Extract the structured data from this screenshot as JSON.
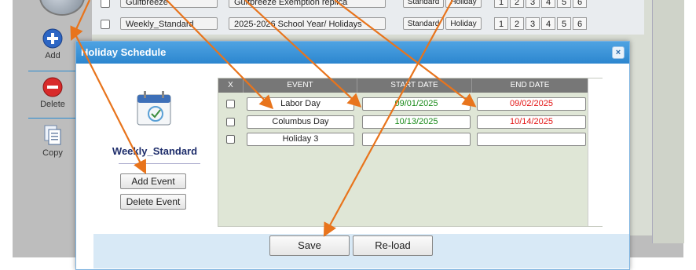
{
  "background_table": {
    "rows": [
      {
        "name": "Gulfbreeze",
        "description": "Gulfbreeze Exemption replica",
        "standard": "Standard",
        "holiday": "Holiday",
        "numbers": [
          "1",
          "2",
          "3",
          "4",
          "5",
          "6"
        ]
      },
      {
        "name": "Weekly_Standard",
        "description": "2025-2026 School Year/ Holidays",
        "standard": "Standard",
        "holiday": "Holiday",
        "numbers": [
          "1",
          "2",
          "3",
          "4",
          "5",
          "6"
        ]
      }
    ]
  },
  "sidebar": {
    "items": [
      {
        "label": "Add",
        "icon": "add-icon"
      },
      {
        "label": "Delete",
        "icon": "delete-icon"
      },
      {
        "label": "Copy",
        "icon": "copy-icon"
      }
    ]
  },
  "modal": {
    "title": "Holiday Schedule",
    "close_label": "×",
    "schedule_name": "Weekly_Standard",
    "add_event_label": "Add Event",
    "delete_event_label": "Delete Event",
    "table": {
      "headers": [
        "X",
        "EVENT",
        "START DATE",
        "END DATE"
      ],
      "rows": [
        {
          "event": "Labor Day",
          "start": "09/01/2025",
          "end": "09/02/2025"
        },
        {
          "event": "Columbus Day",
          "start": "10/13/2025",
          "end": "10/14/2025"
        },
        {
          "event": "Holiday 3",
          "start": "",
          "end": ""
        }
      ]
    },
    "save_label": "Save",
    "reload_label": "Re-load"
  },
  "colors": {
    "start_date": "#1a8a1a",
    "end_date": "#e31414",
    "header_blue": "#2c86cf",
    "arrow": "#e8741c"
  }
}
